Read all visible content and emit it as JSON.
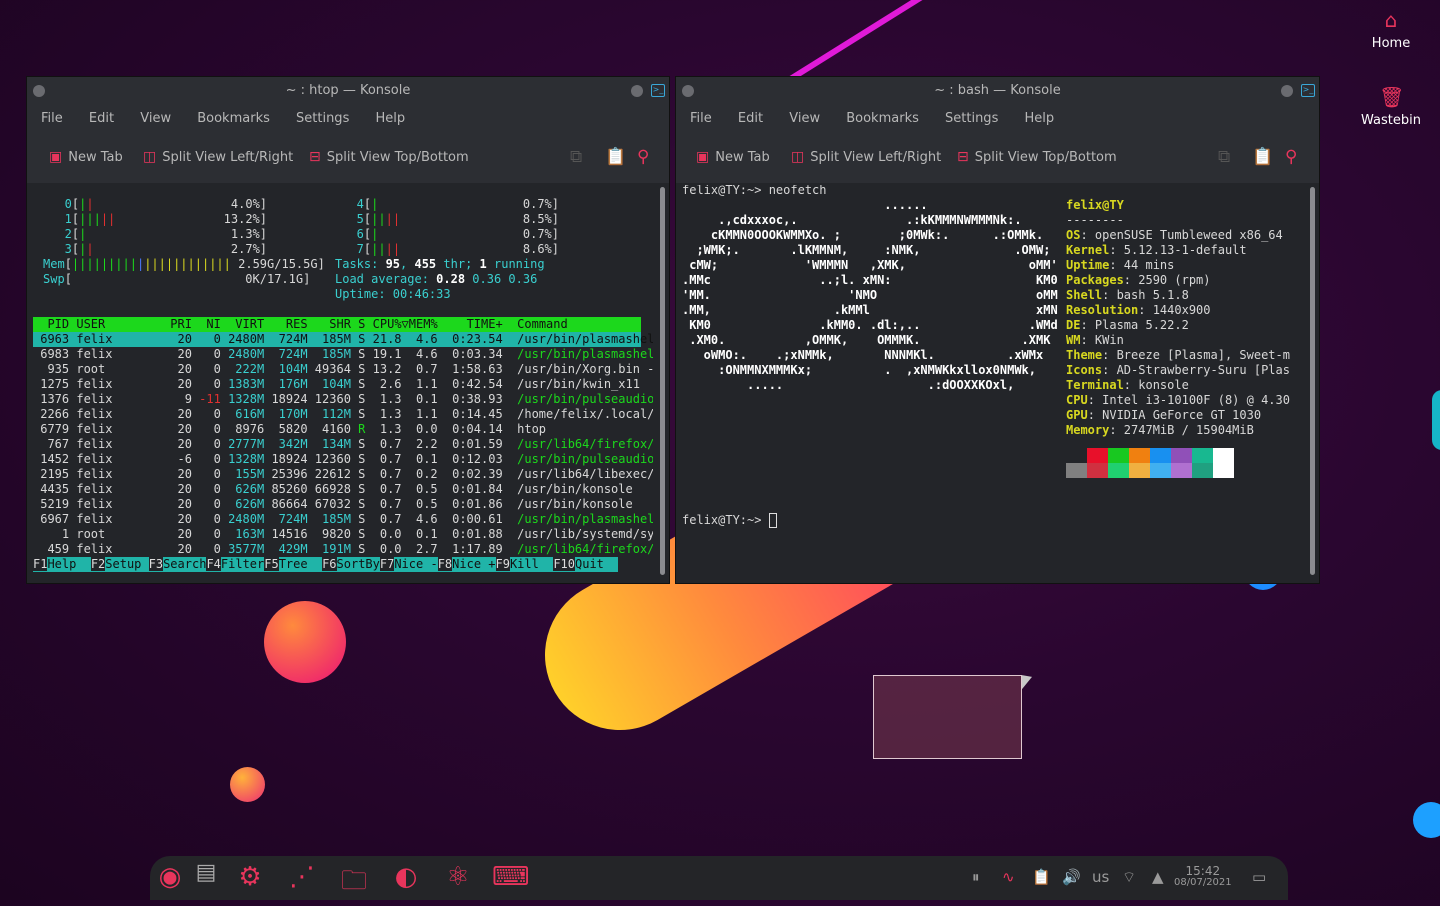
{
  "desktop": {
    "icons": [
      {
        "label": "Home",
        "icon": "home-icon"
      },
      {
        "label": "Wastebin",
        "icon": "trash-icon"
      }
    ]
  },
  "htop_window": {
    "title": "~ : htop — Konsole",
    "menu": [
      "File",
      "Edit",
      "View",
      "Bookmarks",
      "Settings",
      "Help"
    ],
    "toolbar": {
      "new_tab": "New Tab",
      "split_lr": "Split View Left/Right",
      "split_tb": "Split View Top/Bottom"
    },
    "cpus_left": [
      {
        "label": "0",
        "bars": "||",
        "value": "4.0%"
      },
      {
        "label": "1",
        "bars": "|||||",
        "value": "13.2%"
      },
      {
        "label": "2",
        "bars": "|",
        "value": "1.3%"
      },
      {
        "label": "3",
        "bars": "||",
        "value": "2.7%"
      }
    ],
    "cpus_right": [
      {
        "label": "4",
        "bars": "|",
        "value": "0.7%"
      },
      {
        "label": "5",
        "bars": "||||",
        "value": "8.5%"
      },
      {
        "label": "6",
        "bars": "|",
        "value": "0.7%"
      },
      {
        "label": "7",
        "bars": "||||",
        "value": "8.6%"
      }
    ],
    "mem": {
      "label": "Mem",
      "bars": "||||||||||||||||||||||",
      "value": "2.59G/15.5G"
    },
    "swp": {
      "label": "Swp",
      "value": "0K/17.1G"
    },
    "tasks": {
      "prefix": "Tasks: ",
      "tasks": "95",
      "mid": ", ",
      "threads": "455",
      "thr": " thr; ",
      "running": "1",
      "suffix": " running"
    },
    "load": {
      "prefix": "Load average: ",
      "l1": "0.28",
      "l2": "0.36",
      "l3": "0.36"
    },
    "uptime": {
      "prefix": "Uptime: ",
      "value": "00:46:33"
    },
    "columns": [
      "PID",
      "USER",
      "PRI",
      "NI",
      "VIRT",
      "RES",
      "SHR",
      "S",
      "CPU%▽",
      "MEM%",
      "TIME+",
      "Command"
    ],
    "processes": [
      [
        "6963",
        "felix",
        "20",
        "0",
        "2480M",
        "724M",
        "185M",
        "S",
        "21.8",
        "4.6",
        "0:23.54",
        "/usr/bin/plasmashell"
      ],
      [
        "6983",
        "felix",
        "20",
        "0",
        "2480M",
        "724M",
        "185M",
        "S",
        "19.1",
        "4.6",
        "0:03.34",
        "/usr/bin/plasmashell"
      ],
      [
        "935",
        "root",
        "20",
        "0",
        "222M",
        "104M",
        "49364",
        "S",
        "13.2",
        "0.7",
        "1:58.63",
        "/usr/bin/Xorg.bin -nolis"
      ],
      [
        "1275",
        "felix",
        "20",
        "0",
        "1383M",
        "176M",
        "104M",
        "S",
        "2.6",
        "1.1",
        "0:42.54",
        "/usr/bin/kwin_x11"
      ],
      [
        "1376",
        "felix",
        "9",
        "-11",
        "1328M",
        "18924",
        "12360",
        "S",
        "1.3",
        "0.1",
        "0:38.93",
        "/usr/bin/pulseaudio --da"
      ],
      [
        "2266",
        "felix",
        "20",
        "0",
        "616M",
        "170M",
        "112M",
        "S",
        "1.3",
        "1.1",
        "0:14.45",
        "/home/felix/.local/share"
      ],
      [
        "6779",
        "felix",
        "20",
        "0",
        "8976",
        "5820",
        "4160",
        "R",
        "1.3",
        "0.0",
        "0:04.14",
        "htop"
      ],
      [
        "767",
        "felix",
        "20",
        "0",
        "2777M",
        "342M",
        "134M",
        "S",
        "0.7",
        "2.2",
        "0:01.59",
        "/usr/lib64/firefox/firef"
      ],
      [
        "1452",
        "felix",
        "-6",
        "0",
        "1328M",
        "18924",
        "12360",
        "S",
        "0.7",
        "0.1",
        "0:12.03",
        "/usr/bin/pulseaudio --da"
      ],
      [
        "2195",
        "felix",
        "20",
        "0",
        "155M",
        "25396",
        "22612",
        "S",
        "0.7",
        "0.2",
        "0:02.39",
        "/usr/lib64/libexec/kf5/k"
      ],
      [
        "4435",
        "felix",
        "20",
        "0",
        "626M",
        "85260",
        "66928",
        "S",
        "0.7",
        "0.5",
        "0:01.84",
        "/usr/bin/konsole"
      ],
      [
        "5219",
        "felix",
        "20",
        "0",
        "626M",
        "86664",
        "67032",
        "S",
        "0.7",
        "0.5",
        "0:01.86",
        "/usr/bin/konsole"
      ],
      [
        "6967",
        "felix",
        "20",
        "0",
        "2480M",
        "724M",
        "185M",
        "S",
        "0.7",
        "4.6",
        "0:00.61",
        "/usr/bin/plasmashell"
      ],
      [
        "1",
        "root",
        "20",
        "0",
        "163M",
        "14516",
        "9820",
        "S",
        "0.0",
        "0.1",
        "0:01.88",
        "/usr/lib/systemd/systemd"
      ],
      [
        "459",
        "felix",
        "20",
        "0",
        "3577M",
        "429M",
        "191M",
        "S",
        "0.0",
        "2.7",
        "1:17.89",
        "/usr/lib64/firefox/firef"
      ]
    ],
    "fkeys": [
      {
        "k": "F1",
        "l": "Help  "
      },
      {
        "k": "F2",
        "l": "Setup "
      },
      {
        "k": "F3",
        "l": "Search"
      },
      {
        "k": "F4",
        "l": "Filter"
      },
      {
        "k": "F5",
        "l": "Tree  "
      },
      {
        "k": "F6",
        "l": "SortBy"
      },
      {
        "k": "F7",
        "l": "Nice -"
      },
      {
        "k": "F8",
        "l": "Nice +"
      },
      {
        "k": "F9",
        "l": "Kill  "
      },
      {
        "k": "F10",
        "l": "Quit  "
      }
    ]
  },
  "bash_window": {
    "title": "~ : bash — Konsole",
    "menu": [
      "File",
      "Edit",
      "View",
      "Bookmarks",
      "Settings",
      "Help"
    ],
    "toolbar": {
      "new_tab": "New Tab",
      "split_lr": "Split View Left/Right",
      "split_tb": "Split View Top/Bottom"
    },
    "prompt": "felix@TY:~> ",
    "command": "neofetch",
    "logo": [
      "                            ......",
      "     .,cdxxxoc,.               .:kKMMMNWMMMNk:.",
      "    cKMMN0OOOKWMMXo. ;        ;0MWk:.      .:OMMk.",
      "  ;WMK;.       .lKMMNM,     :NMK,             .OMW;",
      " cMW;            'WMMMN   ,XMK,                 oMM'",
      ".MMc               ..;l. xMN:                    KM0",
      "'MM.                   'NMO                      oMM",
      ".MM,                 .kMMl                       xMN",
      " KM0               .kMM0. .dl:,..               .WMd",
      " .XM0.           ,OMMK,    OMMMK.              .XMK",
      "   oWMO:.    .;xNMMk,       NNNMKl.          .xWMx",
      "     :ONMMNXMMMKx;          .  ,xNMWKkxllox0NMWk,",
      "         .....                    .:dOOXXKOxl,"
    ],
    "info_user": "felix@TY",
    "info_sep": "--------",
    "info": [
      {
        "k": "OS",
        "v": ": openSUSE Tumbleweed x86_64"
      },
      {
        "k": "Kernel",
        "v": ": 5.12.13-1-default"
      },
      {
        "k": "Uptime",
        "v": ": 44 mins"
      },
      {
        "k": "Packages",
        "v": ": 2590 (rpm)"
      },
      {
        "k": "Shell",
        "v": ": bash 5.1.8"
      },
      {
        "k": "Resolution",
        "v": ": 1440x900"
      },
      {
        "k": "DE",
        "v": ": Plasma 5.22.2"
      },
      {
        "k": "WM",
        "v": ": KWin"
      },
      {
        "k": "Theme",
        "v": ": Breeze [Plasma], Sweet-m"
      },
      {
        "k": "Icons",
        "v": ": AD-Strawberry-Suru [Plas"
      },
      {
        "k": "Terminal",
        "v": ": konsole"
      },
      {
        "k": "CPU",
        "v": ": Intel i3-10100F (8) @ 4.30"
      },
      {
        "k": "GPU",
        "v": ": NVIDIA GeForce GT 1030"
      },
      {
        "k": "Memory",
        "v": ": 2747MiB / 15904MiB"
      }
    ],
    "palette_top": [
      "#232529",
      "#e8102a",
      "#18c820",
      "#f08010",
      "#1890f0",
      "#9050b8",
      "#18b890",
      "#ffffff"
    ],
    "palette_bottom": [
      "#808080",
      "#d03040",
      "#20d070",
      "#f0b040",
      "#40b0f0",
      "#b070d0",
      "#20a080",
      "#ffffff"
    ],
    "prompt2": "felix@TY:~> "
  },
  "panel": {
    "clock_time": "15:42",
    "clock_date": "08/07/2021",
    "keyboard_layout": "us"
  }
}
